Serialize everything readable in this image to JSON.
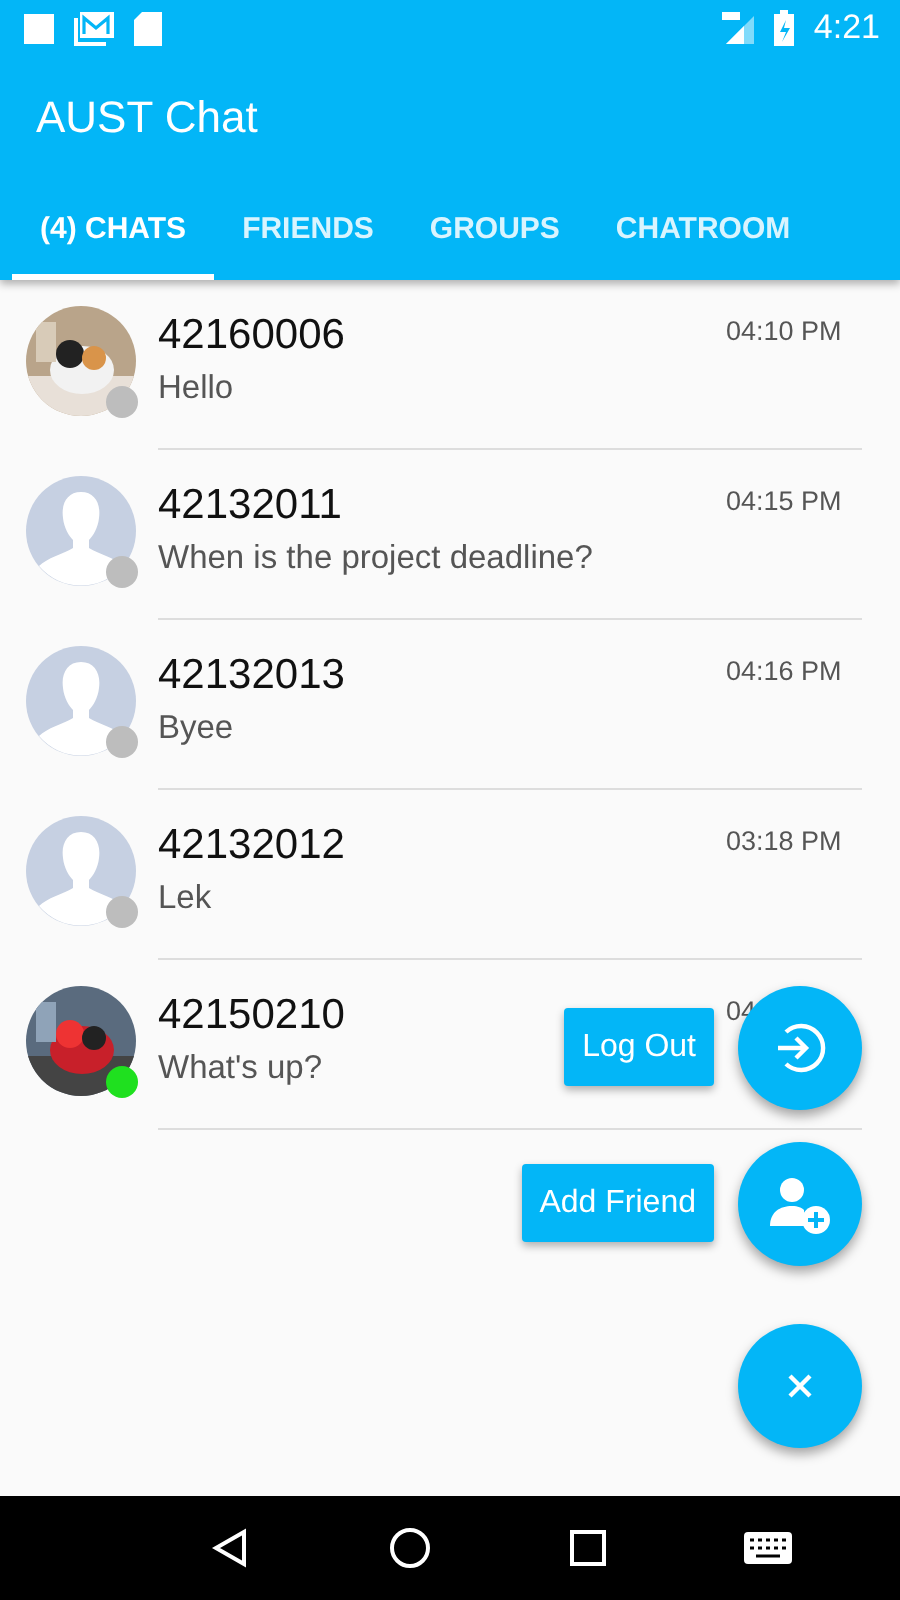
{
  "status_bar": {
    "time": "4:21"
  },
  "app_bar": {
    "title": "AUST Chat"
  },
  "tabs": [
    {
      "label": "(4) CHATS",
      "selected": true
    },
    {
      "label": "FRIENDS",
      "selected": false
    },
    {
      "label": "GROUPS",
      "selected": false
    },
    {
      "label": "CHATROOM",
      "selected": false
    }
  ],
  "chats": [
    {
      "name": "42160006",
      "message": "Hello",
      "time": "04:10 PM",
      "online": false
    },
    {
      "name": "42132011",
      "message": "When is the project deadline?",
      "time": "04:15 PM",
      "kind": "default",
      "online": false
    },
    {
      "name": "42132013",
      "message": "Byee",
      "time": "04:16 PM",
      "kind": "default",
      "online": false
    },
    {
      "name": "42132012",
      "message": "Lek",
      "time": "03:18 PM",
      "kind": "default",
      "online": false
    },
    {
      "name": "42150210",
      "message": "What's up?",
      "time": "04",
      "online": true
    }
  ],
  "fab_menu": {
    "expanded": true,
    "actions": [
      {
        "label": "Log Out",
        "kind": "logout"
      },
      {
        "label": "Add Friend",
        "kind": "add_friend"
      }
    ]
  }
}
